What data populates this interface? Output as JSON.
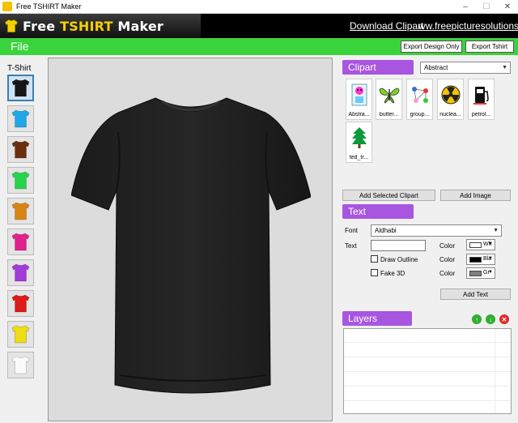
{
  "window": {
    "title": "Free TSHIRT Maker",
    "min": "–",
    "max": "☐",
    "close": "✕"
  },
  "banner": {
    "brand_prefix": "Free ",
    "brand_accent": "TSHIRT",
    "brand_suffix": " Maker",
    "download_link": "Download Clipart",
    "site_link": "ww.freepicturesolutions.co"
  },
  "menu": {
    "file": "File",
    "export_design": "Export Design Only",
    "export_tshirt": "Export Tshirt"
  },
  "tshirt": {
    "label": "T-Shirt",
    "colors": [
      "#161616",
      "#1fa7e6",
      "#6b2e0e",
      "#25d44a",
      "#d88413",
      "#e0218f",
      "#a43ad8",
      "#de1a1a",
      "#eedd13",
      "#fafafa"
    ],
    "selected_index": 0
  },
  "clipart": {
    "title": "Clipart",
    "category": "Abstract",
    "items": [
      {
        "label": "Abstra...",
        "icon": "abstract-face-icon"
      },
      {
        "label": "butter...",
        "icon": "butterfly-icon"
      },
      {
        "label": "group...",
        "icon": "group-network-icon"
      },
      {
        "label": "nuclea...",
        "icon": "nuclear-icon"
      },
      {
        "label": "petrol...",
        "icon": "petrol-pump-icon"
      },
      {
        "label": "ted_tr...",
        "icon": "tree-icon"
      }
    ],
    "add_selected": "Add Selected Clipart",
    "add_image": "Add Image"
  },
  "text": {
    "title": "Text",
    "font_label": "Font",
    "font_value": "Aldhabi",
    "text_label": "Text",
    "text_value": "",
    "draw_outline": "Draw Outline",
    "fake_3d": "Fake 3D",
    "color_label": "Color",
    "colors": [
      {
        "name": "Wh",
        "hex": "#ffffff"
      },
      {
        "name": "Bla",
        "hex": "#000000"
      },
      {
        "name": "Gr",
        "hex": "#808080"
      }
    ],
    "add_text": "Add Text"
  },
  "layers": {
    "title": "Layers"
  }
}
